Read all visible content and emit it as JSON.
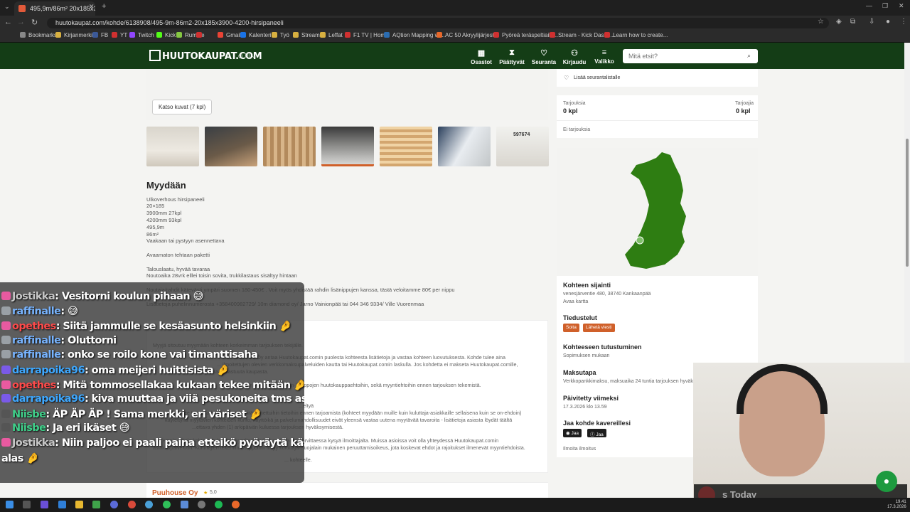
{
  "browser": {
    "tab_title": "495,9m/86m² 20x185x3900-42...",
    "url": "huutokaupat.com/kohde/6138908/495-9m-86m2-20x185x3900-4200-hirsipaneeli",
    "bookmarks": [
      "Bookmarks",
      "Kirjanmerkit",
      "FB",
      "YT",
      "Twitch",
      "Kick",
      "Rumble",
      "",
      "Gmail",
      "Kalenteri",
      "Työ",
      "Stream",
      "Leffat",
      "F1 TV | Home",
      "AQtion Mapping wi...",
      "AC 50 Akryylijärjest...",
      "Pyöreä teräspeltiaila...",
      "Stream - Kick Dashb...",
      "Learn how to create..."
    ]
  },
  "site": {
    "logo": "HUUTOKAUPAT.COM",
    "lang": "FI",
    "nav": [
      {
        "label": "Osastot",
        "icon": "grid-icon",
        "glyph": "▦"
      },
      {
        "label": "Päättyvät",
        "icon": "hourglass-icon",
        "glyph": "⧗"
      },
      {
        "label": "Seuranta",
        "icon": "heart-icon",
        "glyph": "♡"
      },
      {
        "label": "Kirjaudu",
        "icon": "user-icon",
        "glyph": "⚇"
      },
      {
        "label": "Valikko",
        "icon": "menu-icon",
        "glyph": "≡"
      }
    ],
    "search_placeholder": "Mitä etsit?"
  },
  "main": {
    "more_pictures": "Katso kuvat (7 kpl)",
    "section_title": "Myydään",
    "description": [
      "Ulkoverhous hirsipaneeli",
      "20×185",
      "3900mm 27kpl",
      "4200mm 93kpl",
      "495,9m",
      "86m²",
      "Vaakaan tai pystyyn asennettava",
      "Avaamaton tehtaan paketti",
      "Talouslaatu, hyvää tavaraa",
      "Noutoaika 28vrk elllei toisin sovita, trukkilastaus sisältyy hintaan",
      "Noutaja/rahdit kätevästi ympäri suomen 180-450€ . Voit myös yhdistää rahdin lisänippujen kanssa, tästä veloitamme 80€ per nippu",
      "Lisätietoja puhelinnumerosta +358400982729/ 10m diamond oy/ Jarno Vainionpää tai 044 346 9334/ Ville Vuorenmaa"
    ],
    "info_lines": [
      "Myyjä sitoutuu myymään kohteen korkeimman tarjouksen tekijälle.",
      "...mat. Puuhouse Oy antaa Huutokaupat.comin puolesta kohteesta lisätietoja ja vastaa kohteen luovutuksesta. Kohde tulee aina",
      "... ilmoitettujen olevien verkkomaksupalveluiden kautta tai Huutokaupat.comin laskulla. Jos kohdetta ei makseta Huutokaupat.comille,",
      "... ei hyväksy mitään vastuuta kaupasta.",
      "...n Huutokaupat.com-kauppojen huutokauppaehtoihin, sekä myyntiehtoihin ennen tarjouksen tekemistä.",
      "...eltyä",
      "sinun tulee tutustua kohteeseen ja siitä annettuihin tietoihin ennen tarjoamista (kohteet myydään muille kuin kuluttaja-asiakkaille sellaisena kuin se on-ehdoin)",
      "käytettynä myytävien kohteiden kunto, käyttöikä ja palvelumahdollisuudet eivät yleensä vastaa uutena myytävää tavaroita - lisätietoja asiasta löydät täältä",
      "...ettava yhden (1) arkipäivän kuluessa tarjouksen hyväksymisestä.",
      "Tarkempia tietoja kohteesta ja sen myyntiin liittyvistä asioista voit tarvittaessa kysyä ilmoittajalta. Muissa asioissa voit olla yhteydessä Huutokaupat.comin",
      "asiakaspalveluun. Kuluttajien tekemiin kauppoihin liittyy kuluttajansuojalain mukainen peruuttamisoikeus, jota koskevat ehdot ja rajoitukset ilmenevät myyntiehdoista.",
      "... kohteelle."
    ],
    "seller_name": "Puuhouse Oy",
    "seller_rating": "5,0"
  },
  "sidebar": {
    "watch_label": "Lisää seurantalistalle",
    "offers_label": "Tarjouksia",
    "offers_value": "0 kpl",
    "bidders_label": "Tarjoajia",
    "bidders_value": "0 kpl",
    "no_offers": "Ei tarjouksia",
    "location_title": "Kohteen sijainti",
    "location_address": "venesjärventie 480, 38740 Kankaanpää",
    "open_map": "Avaa kartta",
    "inquiry_title": "Tiedustelut",
    "call_button": "Soita",
    "message_button": "Lähetä viesti",
    "inspection_title": "Kohteeseen tutustuminen",
    "inspection_text": "Sopimuksen mukaan",
    "payment_title": "Maksutapa",
    "payment_text": "Verkkopankkimaksu, maksuaika 24 tuntia tarjouksen hyväksymisestä.",
    "updated_title": "Päivitetty viimeksi",
    "updated_text": "17.3.2026 klo 13.59",
    "share_title": "Jaa kohde kavereillesi",
    "share_whatsapp": "Jaa",
    "share_facebook": "Jaa",
    "report_link": "Ilmoita ilmoitus"
  },
  "chat": [
    {
      "name": "Jostikka",
      "color": "#c8c8c8",
      "text": ": Vesitorni koulun pihaan 😅"
    },
    {
      "name": "raffinalle",
      "color": "#78b4ff",
      "text": ": 😅"
    },
    {
      "name": "opethes",
      "color": "#ff4a4a",
      "text": ": Siitä jammulle se kesäasunto helsinkiin 🤌"
    },
    {
      "name": "raffinalle",
      "color": "#78b4ff",
      "text": ": Oluttorni"
    },
    {
      "name": "raffinalle",
      "color": "#78b4ff",
      "text": ": onko se roilo kone vai timanttisaha"
    },
    {
      "name": "darrapoika96",
      "color": "#3ea8ff",
      "text": ": oma meijeri huittisista 🤌"
    },
    {
      "name": "opethes",
      "color": "#ff4a4a",
      "text": ": Mitä tommosellakaa kukaan tekee mitään 🤌"
    },
    {
      "name": "darrapoika96",
      "color": "#3ea8ff",
      "text": ": kiva muuttaa ja viiä pesukoneita tms asuintiloihin"
    },
    {
      "name": "Niisbe",
      "color": "#3fd08a",
      "text": ": ÄP ÄP ÄP ! Sama merkki, eri väriset 🤌"
    },
    {
      "name": "Niisbe",
      "color": "#3fd08a",
      "text": ": Ja eri ikäset 😅"
    },
    {
      "name": "Jostikka",
      "color": "#c8c8c8",
      "text": ": Niin paljoo ei paali paina etteikö pyöräytä käsin"
    },
    {
      "name": "",
      "color": "#fff",
      "text": "alas 🤌"
    }
  ],
  "stream": {
    "today_label": "s Today"
  },
  "taskbar": {
    "time": "19.41",
    "date": "17.3.2026"
  },
  "colors": {
    "header_green": "#143d16",
    "accent_orange": "#d0602a",
    "map_green": "#2e7d12"
  }
}
